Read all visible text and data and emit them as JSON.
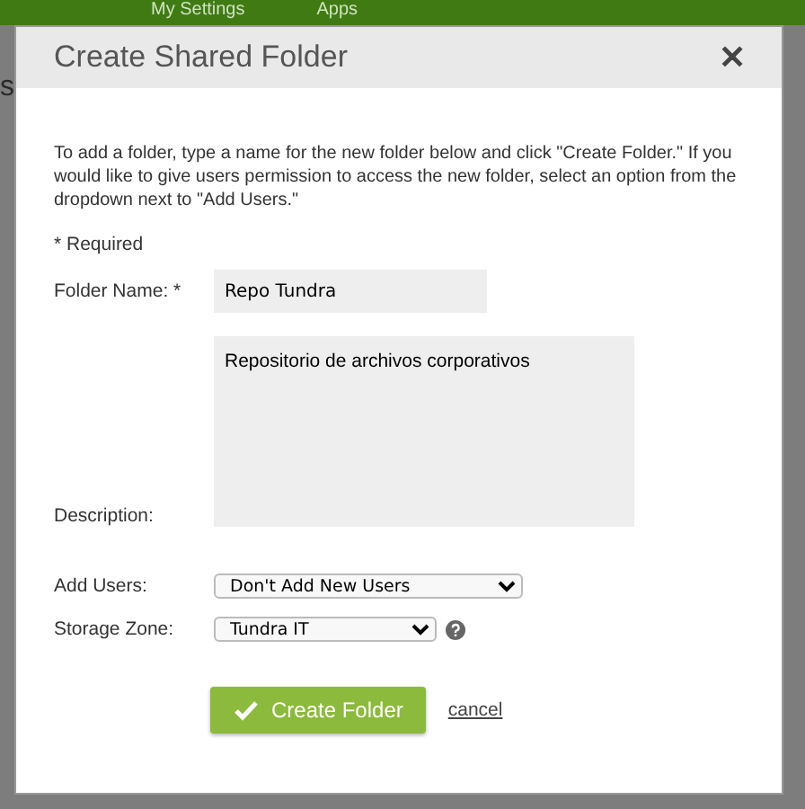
{
  "background": {
    "nav_items": [
      "My Settings",
      "Apps"
    ],
    "side_text": "s"
  },
  "dialog": {
    "title": "Create Shared Folder",
    "close": "✕",
    "intro": "To add a folder, type a name for the new folder below and click \"Create Folder.\" If you would like to give users permission to access the new folder, select an option from the dropdown next to \"Add Users.\"",
    "required_note": "* Required",
    "fields": [
      {
        "kind": "text",
        "label": "Folder Name: *",
        "value": "Repo Tundra"
      },
      {
        "kind": "textarea",
        "label": "Description:",
        "value": "Repositorio de archivos corporativos"
      },
      {
        "kind": "select",
        "label": "Add Users:",
        "value": "Don't Add New Users"
      },
      {
        "kind": "select",
        "label": "Storage Zone:",
        "value": "Tundra IT",
        "help": true
      }
    ],
    "submit": "Create Folder",
    "cancel": "cancel"
  }
}
